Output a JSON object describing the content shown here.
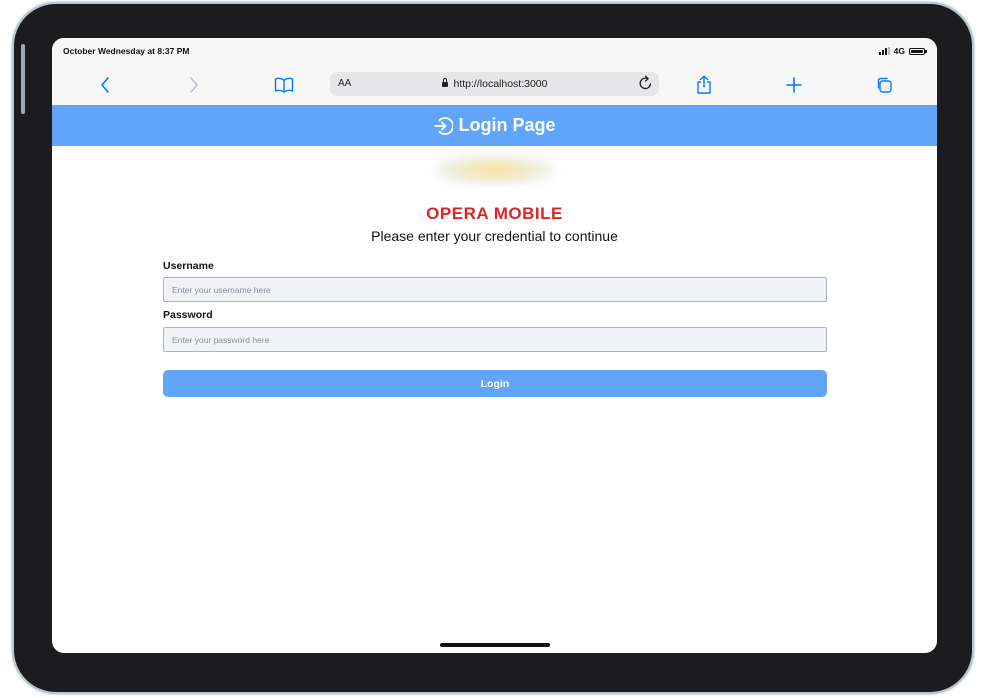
{
  "status_bar": {
    "time": "October Wednesday at 8:37 PM",
    "network": "4G"
  },
  "browser": {
    "aa_label": "AA",
    "url": "http://localhost:3000",
    "icons": {
      "back": "chevron-left-icon",
      "forward": "chevron-right-icon",
      "bookmarks": "book-icon",
      "reload": "reload-icon",
      "share": "share-icon",
      "new_tab": "plus-icon",
      "tabs": "tabs-icon"
    }
  },
  "header": {
    "title": "Login Page",
    "icon": "login-icon"
  },
  "main": {
    "brand": "OPERA MOBILE",
    "subtitle": "Please enter your credential to continue",
    "username": {
      "label": "Username",
      "placeholder": "Enter your username here",
      "value": ""
    },
    "password": {
      "label": "Password",
      "placeholder": "Enter your password here",
      "value": ""
    },
    "login_label": "Login"
  },
  "colors": {
    "accent": "#60a5fa",
    "brand_red": "#dc2626",
    "ios_blue": "#007aff"
  }
}
